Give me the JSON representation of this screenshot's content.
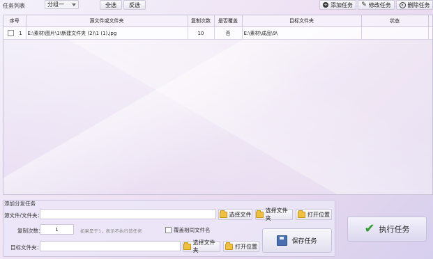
{
  "toolbar": {
    "task_list_label": "任务列表",
    "group_select_value": "分组一",
    "select_all": "全选",
    "invert_select": "反选",
    "add_task": "添加任务",
    "edit_task": "修改任务",
    "delete_task": "删除任务"
  },
  "table": {
    "headers": [
      "序号",
      "源文件或文件夹",
      "复制次数",
      "是否覆盖",
      "目标文件夹",
      "状态"
    ],
    "rows": [
      {
        "index": "1",
        "source": "E:\\素材\\图片\\1\\新建文件夹 (2)\\1 (1).jpg",
        "copies": "10",
        "overwrite": "否",
        "target": "E:\\素材\\成品\\9\\",
        "status": ""
      }
    ]
  },
  "form": {
    "section_title": "添加分发任务",
    "source_label": "源文件/文件夹：",
    "source_value": "",
    "choose_file": "选择文件",
    "choose_folder": "选择文件夹",
    "open_location": "打开位置",
    "copies_label": "复制次数：",
    "copies_value": "1",
    "copies_hint": "如果是于1，表示不执行该任务",
    "overwrite_label": "覆盖相同文件名",
    "target_label": "目标文件夹：",
    "target_value": "",
    "choose_folder2": "选择文件夹",
    "open_location2": "打开位置",
    "save_task": "保存任务",
    "run_task": "执行任务"
  }
}
